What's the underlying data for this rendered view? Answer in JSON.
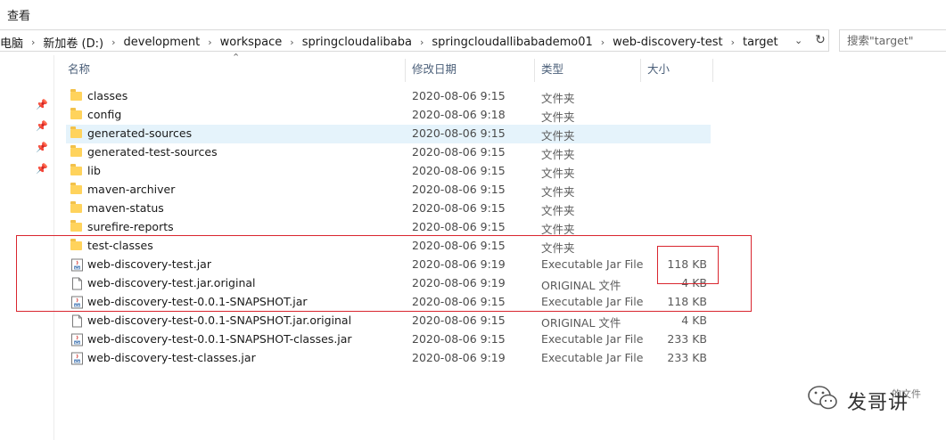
{
  "menubar": {
    "view": "查看"
  },
  "address": {
    "crumbs": [
      "电脑",
      "新加卷 (D:)",
      "development",
      "workspace",
      "springcloudalibaba",
      "springcloudallibabademo01",
      "web-discovery-test",
      "target"
    ]
  },
  "search": {
    "placeholder": "搜索\"target\""
  },
  "columns": {
    "name": "名称",
    "date": "修改日期",
    "type": "类型",
    "size": "大小"
  },
  "files": [
    {
      "name": "classes",
      "date": "2020-08-06 9:15",
      "type": "文件夹",
      "size": "",
      "icon": "folder-icon"
    },
    {
      "name": "config",
      "date": "2020-08-06 9:18",
      "type": "文件夹",
      "size": "",
      "icon": "folder-icon"
    },
    {
      "name": "generated-sources",
      "date": "2020-08-06 9:15",
      "type": "文件夹",
      "size": "",
      "icon": "folder-icon",
      "highlighted": true
    },
    {
      "name": "generated-test-sources",
      "date": "2020-08-06 9:15",
      "type": "文件夹",
      "size": "",
      "icon": "folder-icon"
    },
    {
      "name": "lib",
      "date": "2020-08-06 9:15",
      "type": "文件夹",
      "size": "",
      "icon": "folder-icon"
    },
    {
      "name": "maven-archiver",
      "date": "2020-08-06 9:15",
      "type": "文件夹",
      "size": "",
      "icon": "folder-icon"
    },
    {
      "name": "maven-status",
      "date": "2020-08-06 9:15",
      "type": "文件夹",
      "size": "",
      "icon": "folder-icon"
    },
    {
      "name": "surefire-reports",
      "date": "2020-08-06 9:15",
      "type": "文件夹",
      "size": "",
      "icon": "folder-icon"
    },
    {
      "name": "test-classes",
      "date": "2020-08-06 9:15",
      "type": "文件夹",
      "size": "",
      "icon": "folder-icon"
    },
    {
      "name": "web-discovery-test.jar",
      "date": "2020-08-06 9:19",
      "type": "Executable Jar File",
      "size": "118 KB",
      "icon": "jar-icon"
    },
    {
      "name": "web-discovery-test.jar.original",
      "date": "2020-08-06 9:19",
      "type": "ORIGINAL 文件",
      "size": "4 KB",
      "icon": "file-icon"
    },
    {
      "name": "web-discovery-test-0.0.1-SNAPSHOT.jar",
      "date": "2020-08-06 9:15",
      "type": "Executable Jar File",
      "size": "118 KB",
      "icon": "jar-icon"
    },
    {
      "name": "web-discovery-test-0.0.1-SNAPSHOT.jar.original",
      "date": "2020-08-06 9:15",
      "type": "ORIGINAL 文件",
      "size": "4 KB",
      "icon": "file-icon"
    },
    {
      "name": "web-discovery-test-0.0.1-SNAPSHOT-classes.jar",
      "date": "2020-08-06 9:15",
      "type": "Executable Jar File",
      "size": "233 KB",
      "icon": "jar-icon"
    },
    {
      "name": "web-discovery-test-classes.jar",
      "date": "2020-08-06 9:19",
      "type": "Executable Jar File",
      "size": "233 KB",
      "icon": "jar-icon"
    }
  ],
  "watermark": {
    "text": "发哥讲",
    "suffix": "的文件"
  },
  "colors": {
    "annotation": "#d9262f",
    "folder": "#ffd35c",
    "selection": "#e5f3fb"
  }
}
